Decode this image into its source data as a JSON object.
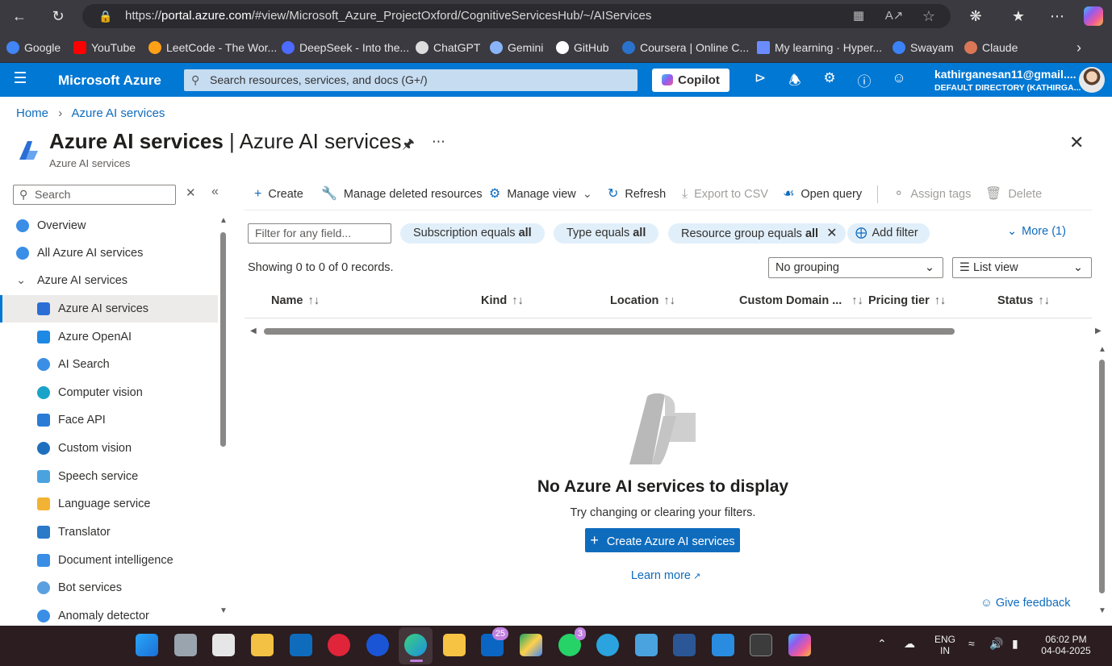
{
  "browser": {
    "url_prefix": "https://",
    "url_host": "portal.azure.com",
    "url_path": "/#view/Microsoft_Azure_ProjectOxford/CognitiveServicesHub/~/AIServices",
    "bookmarks": [
      {
        "label": "Google",
        "color": "#4285f4"
      },
      {
        "label": "YouTube",
        "color": "#ff0000"
      },
      {
        "label": "LeetCode - The Wor...",
        "color": "#ffa116"
      },
      {
        "label": "DeepSeek - Into the...",
        "color": "#4d6bfe"
      },
      {
        "label": "ChatGPT",
        "color": "#dddddd"
      },
      {
        "label": "Gemini",
        "color": "#8ab4f8"
      },
      {
        "label": "GitHub",
        "color": "#ffffff"
      },
      {
        "label": "Coursera | Online C...",
        "color": "#2a73cc"
      },
      {
        "label": "My learning · Hyper...",
        "color": "#6a8cff"
      },
      {
        "label": "Swayam",
        "color": "#3b82f6"
      },
      {
        "label": "Claude",
        "color": "#d97757"
      }
    ]
  },
  "azure_header": {
    "brand": "Microsoft Azure",
    "search_placeholder": "Search resources, services, and docs (G+/)",
    "copilot_label": "Copilot",
    "account_email": "kathirganesan11@gmail....",
    "account_directory": "DEFAULT DIRECTORY (KATHIRGA..."
  },
  "breadcrumb": {
    "home": "Home",
    "current": "Azure AI services"
  },
  "page": {
    "title_bold": "Azure AI services",
    "title_rest": " | Azure AI services",
    "subtitle": "Azure AI services"
  },
  "sidebar": {
    "search_placeholder": "Search",
    "items": [
      {
        "label": "Overview",
        "color": "#3a8ee6"
      },
      {
        "label": "All Azure AI services",
        "color": "#3a8ee6"
      },
      {
        "label": "Azure AI services",
        "color": "#605e5c"
      },
      {
        "label": "Azure AI services",
        "color": "#2b6fd6"
      },
      {
        "label": "Azure OpenAI",
        "color": "#1e88e5"
      },
      {
        "label": "AI Search",
        "color": "#3a8ee6"
      },
      {
        "label": "Computer vision",
        "color": "#1aa3c9"
      },
      {
        "label": "Face API",
        "color": "#2a7bd5"
      },
      {
        "label": "Custom vision",
        "color": "#1f6fbf"
      },
      {
        "label": "Speech service",
        "color": "#4aa3df"
      },
      {
        "label": "Language service",
        "color": "#f2b233"
      },
      {
        "label": "Translator",
        "color": "#2b79c9"
      },
      {
        "label": "Document intelligence",
        "color": "#3a8ee6"
      },
      {
        "label": "Bot services",
        "color": "#5aa0e0"
      },
      {
        "label": "Anomaly detector",
        "color": "#3a8ee6"
      }
    ]
  },
  "toolbar": {
    "create": "Create",
    "manage_deleted": "Manage deleted resources",
    "manage_view": "Manage view",
    "refresh": "Refresh",
    "export_csv": "Export to CSV",
    "open_query": "Open query",
    "assign_tags": "Assign tags",
    "delete": "Delete"
  },
  "filters": {
    "input_placeholder": "Filter for any field...",
    "subscription_label": "Subscription equals ",
    "subscription_value": "all",
    "type_label": "Type equals ",
    "type_value": "all",
    "rg_label": "Resource group equals ",
    "rg_value": "all",
    "add_filter": "Add filter",
    "more": "More (1)"
  },
  "records": {
    "summary": "Showing 0 to 0 of 0 records.",
    "grouping": "No grouping",
    "view": "List view"
  },
  "table": {
    "columns": [
      "Name",
      "Kind",
      "Location",
      "Custom Domain ...",
      "Pricing tier",
      "Status"
    ]
  },
  "empty_state": {
    "title": "No Azure AI services to display",
    "subtitle": "Try changing or clearing your filters.",
    "create_button": "Create Azure AI services",
    "learn_more": "Learn more"
  },
  "feedback": "Give feedback",
  "taskbar": {
    "linkedin_badge": "25",
    "whatsapp_badge": "3",
    "lang_top": "ENG",
    "lang_bottom": "IN",
    "time": "06:02 PM",
    "date": "04-04-2025"
  }
}
